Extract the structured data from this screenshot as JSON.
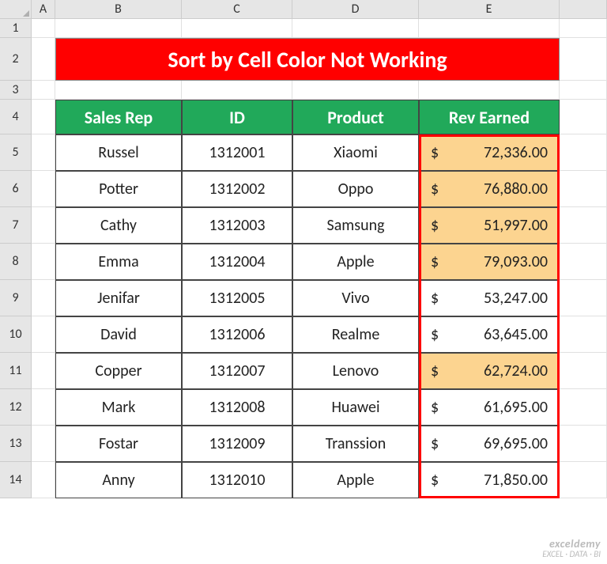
{
  "columns": [
    "A",
    "B",
    "C",
    "D",
    "E"
  ],
  "rows": [
    "1",
    "2",
    "3",
    "4",
    "5",
    "6",
    "7",
    "8",
    "9",
    "10",
    "11",
    "12",
    "13",
    "14"
  ],
  "title": "Sort by Cell Color Not Working",
  "headers": [
    "Sales Rep",
    "ID",
    "Product",
    "Rev Earned"
  ],
  "data": [
    {
      "rep": "Russel",
      "id": "1312001",
      "product": "Xiaomi",
      "rev": "72,336.00",
      "highlight": true
    },
    {
      "rep": "Potter",
      "id": "1312002",
      "product": "Oppo",
      "rev": "76,880.00",
      "highlight": true
    },
    {
      "rep": "Cathy",
      "id": "1312003",
      "product": "Samsung",
      "rev": "51,997.00",
      "highlight": true
    },
    {
      "rep": "Emma",
      "id": "1312004",
      "product": "Apple",
      "rev": "79,093.00",
      "highlight": true
    },
    {
      "rep": "Jenifar",
      "id": "1312005",
      "product": "Vivo",
      "rev": "53,247.00",
      "highlight": false
    },
    {
      "rep": "David",
      "id": "1312006",
      "product": "Realme",
      "rev": "63,645.00",
      "highlight": false
    },
    {
      "rep": "Copper",
      "id": "1312007",
      "product": "Lenovo",
      "rev": "62,724.00",
      "highlight": true
    },
    {
      "rep": "Mark",
      "id": "1312008",
      "product": "Huawei",
      "rev": "61,695.00",
      "highlight": false
    },
    {
      "rep": "Fostar",
      "id": "1312009",
      "product": "Transsion",
      "rev": "69,695.00",
      "highlight": false
    },
    {
      "rep": "Anny",
      "id": "1312010",
      "product": "Apple",
      "rev": "71,850.00",
      "highlight": false
    }
  ],
  "currency": "$",
  "watermark": {
    "brand": "exceldemy",
    "tag": "EXCEL · DATA · BI"
  }
}
